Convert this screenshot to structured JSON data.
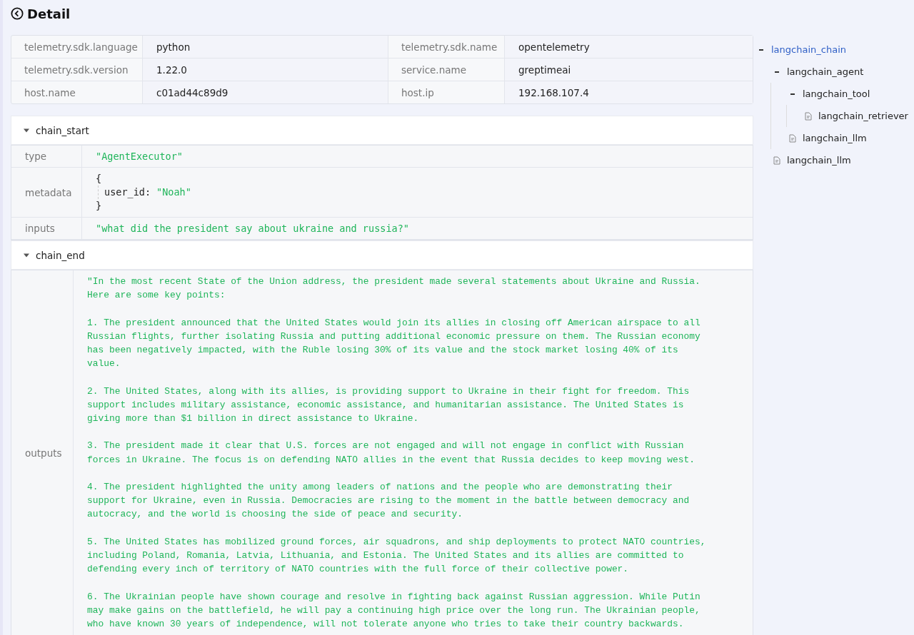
{
  "header": {
    "title": "Detail"
  },
  "attributes": [
    {
      "key": "telemetry.sdk.language",
      "value": "python"
    },
    {
      "key": "telemetry.sdk.name",
      "value": "opentelemetry"
    },
    {
      "key": "telemetry.sdk.version",
      "value": "1.22.0"
    },
    {
      "key": "service.name",
      "value": "greptimeai"
    },
    {
      "key": "host.name",
      "value": "c01ad44c89d9"
    },
    {
      "key": "host.ip",
      "value": "192.168.107.4"
    }
  ],
  "sections": [
    {
      "title": "chain_start",
      "expanded": true,
      "rows": [
        {
          "key": "type",
          "kind": "string",
          "value": "\"AgentExecutor\""
        },
        {
          "key": "metadata",
          "kind": "object",
          "open": "{",
          "close": "}",
          "entries": [
            {
              "key": "user_id:",
              "value": "\"Noah\""
            }
          ]
        },
        {
          "key": "inputs",
          "kind": "string",
          "value": "\"what did the president say about ukraine and russia?\""
        }
      ]
    },
    {
      "title": "chain_end",
      "expanded": true,
      "rows": [
        {
          "key": "outputs",
          "kind": "text",
          "value": "\"In the most recent State of the Union address, the president made several statements about Ukraine and Russia.\nHere are some key points:\n\n1. The president announced that the United States would join its allies in closing off American airspace to all\nRussian flights, further isolating Russia and putting additional economic pressure on them. The Russian economy\nhas been negatively impacted, with the Ruble losing 30% of its value and the stock market losing 40% of its\nvalue.\n\n2. The United States, along with its allies, is providing support to Ukraine in their fight for freedom. This\nsupport includes military assistance, economic assistance, and humanitarian assistance. The United States is\ngiving more than $1 billion in direct assistance to Ukraine.\n\n3. The president made it clear that U.S. forces are not engaged and will not engage in conflict with Russian\nforces in Ukraine. The focus is on defending NATO allies in the event that Russia decides to keep moving west.\n\n4. The president highlighted the unity among leaders of nations and the people who are demonstrating their\nsupport for Ukraine, even in Russia. Democracies are rising to the moment in the battle between democracy and\nautocracy, and the world is choosing the side of peace and security.\n\n5. The United States has mobilized ground forces, air squadrons, and ship deployments to protect NATO countries,\nincluding Poland, Romania, Latvia, Lithuania, and Estonia. The United States and its allies are committed to\ndefending every inch of territory of NATO countries with the full force of their collective power.\n\n6. The Ukrainian people have shown courage and resolve in fighting back against Russian aggression. While Putin\nmay make gains on the battlefield, he will pay a continuing high price over the long run. The Ukrainian people,\nwho have known 30 years of independence, will not tolerate anyone who tries to take their country backwards."
        }
      ]
    }
  ],
  "tree": [
    {
      "label": "langchain_chain",
      "selected": true,
      "expanded": true,
      "children": [
        {
          "label": "langchain_agent",
          "selected": false,
          "expanded": true,
          "children": [
            {
              "label": "langchain_tool",
              "selected": false,
              "expanded": true,
              "children": [
                {
                  "label": "langchain_retriever",
                  "selected": false
                }
              ]
            },
            {
              "label": "langchain_llm",
              "selected": false
            }
          ]
        },
        {
          "label": "langchain_llm",
          "selected": false
        }
      ]
    }
  ]
}
